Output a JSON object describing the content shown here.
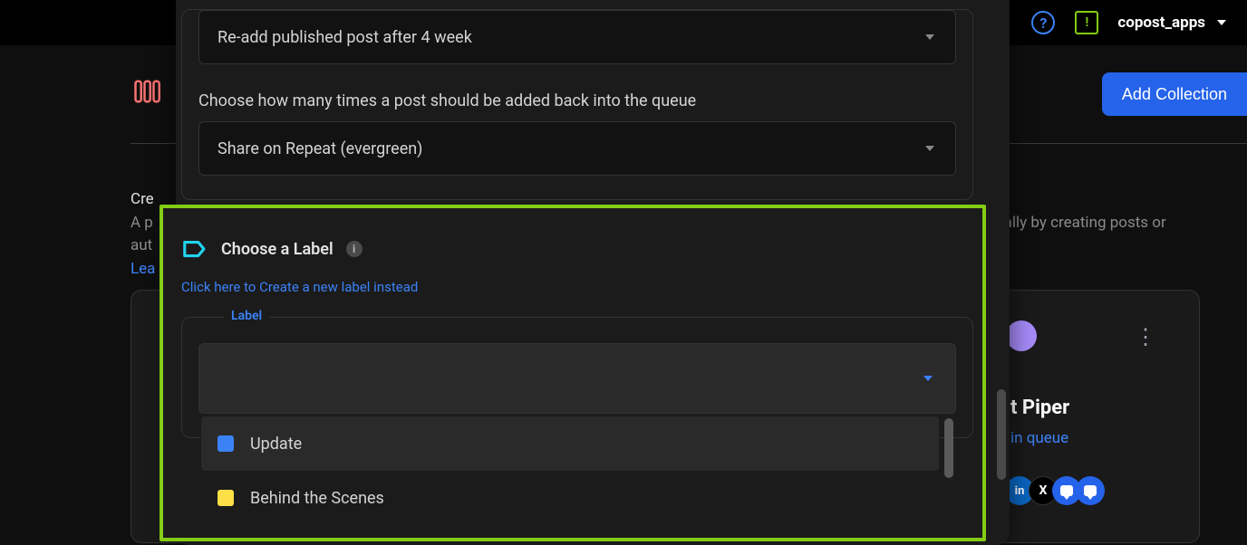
{
  "topbar": {
    "account_name": "copost_apps"
  },
  "page": {
    "add_collection_label": "Add Collection",
    "heading": "Cre",
    "sub_line1_prefix": "A p",
    "sub_line1_suffix": "nually by creating posts or",
    "sub_line2": "aut",
    "learn_label": "Lea"
  },
  "card": {
    "title_fragment": "t Piper",
    "queue_fragment": "in queue"
  },
  "modal": {
    "select1_value": "Re-add published post after 4 week",
    "repeat_instruction": "Choose how many times a post should be added back into the queue",
    "select2_value": "Share on Repeat (evergreen)",
    "choose_label_title": "Choose a Label",
    "create_label_link": "Click here to Create a new label instead",
    "floating_label": "Label",
    "options": [
      {
        "color": "blue",
        "name": "Update"
      },
      {
        "color": "yellow",
        "name": "Behind the Scenes"
      }
    ]
  }
}
